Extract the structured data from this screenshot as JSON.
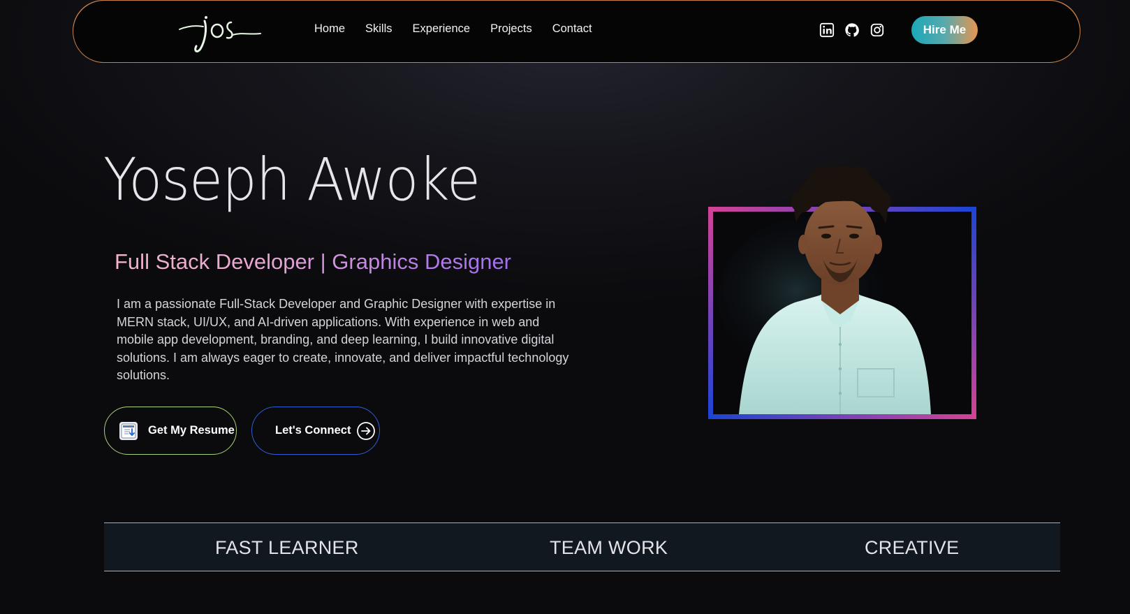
{
  "nav": {
    "logo_text": "jos",
    "links": [
      "Home",
      "Skills",
      "Experience",
      "Projects",
      "Contact"
    ],
    "socials": [
      "linkedin-icon",
      "github-icon",
      "instagram-icon"
    ],
    "hire_label": "Hire Me"
  },
  "hero": {
    "name": "Yoseph Awoke",
    "title": "Full Stack Developer | Graphics Designer",
    "description": "I am a passionate Full-Stack Developer and Graphic Designer with expertise in MERN stack, UI/UX, and AI-driven applications. With experience in web and mobile app development, branding, and deep learning, I build innovative digital solutions. I am always eager to create, innovate, and deliver impactful technology solutions.",
    "resume_label": "Get My Resume",
    "connect_label": "Let's Connect"
  },
  "strip": {
    "items": [
      "FAST LEARNER",
      "TEAM WORK",
      "CREATIVE"
    ]
  },
  "colors": {
    "accent_orange": "#c97f45",
    "accent_blue": "#2f5ed8",
    "accent_green": "#a9d37a",
    "accent_pink": "#d93f93"
  }
}
